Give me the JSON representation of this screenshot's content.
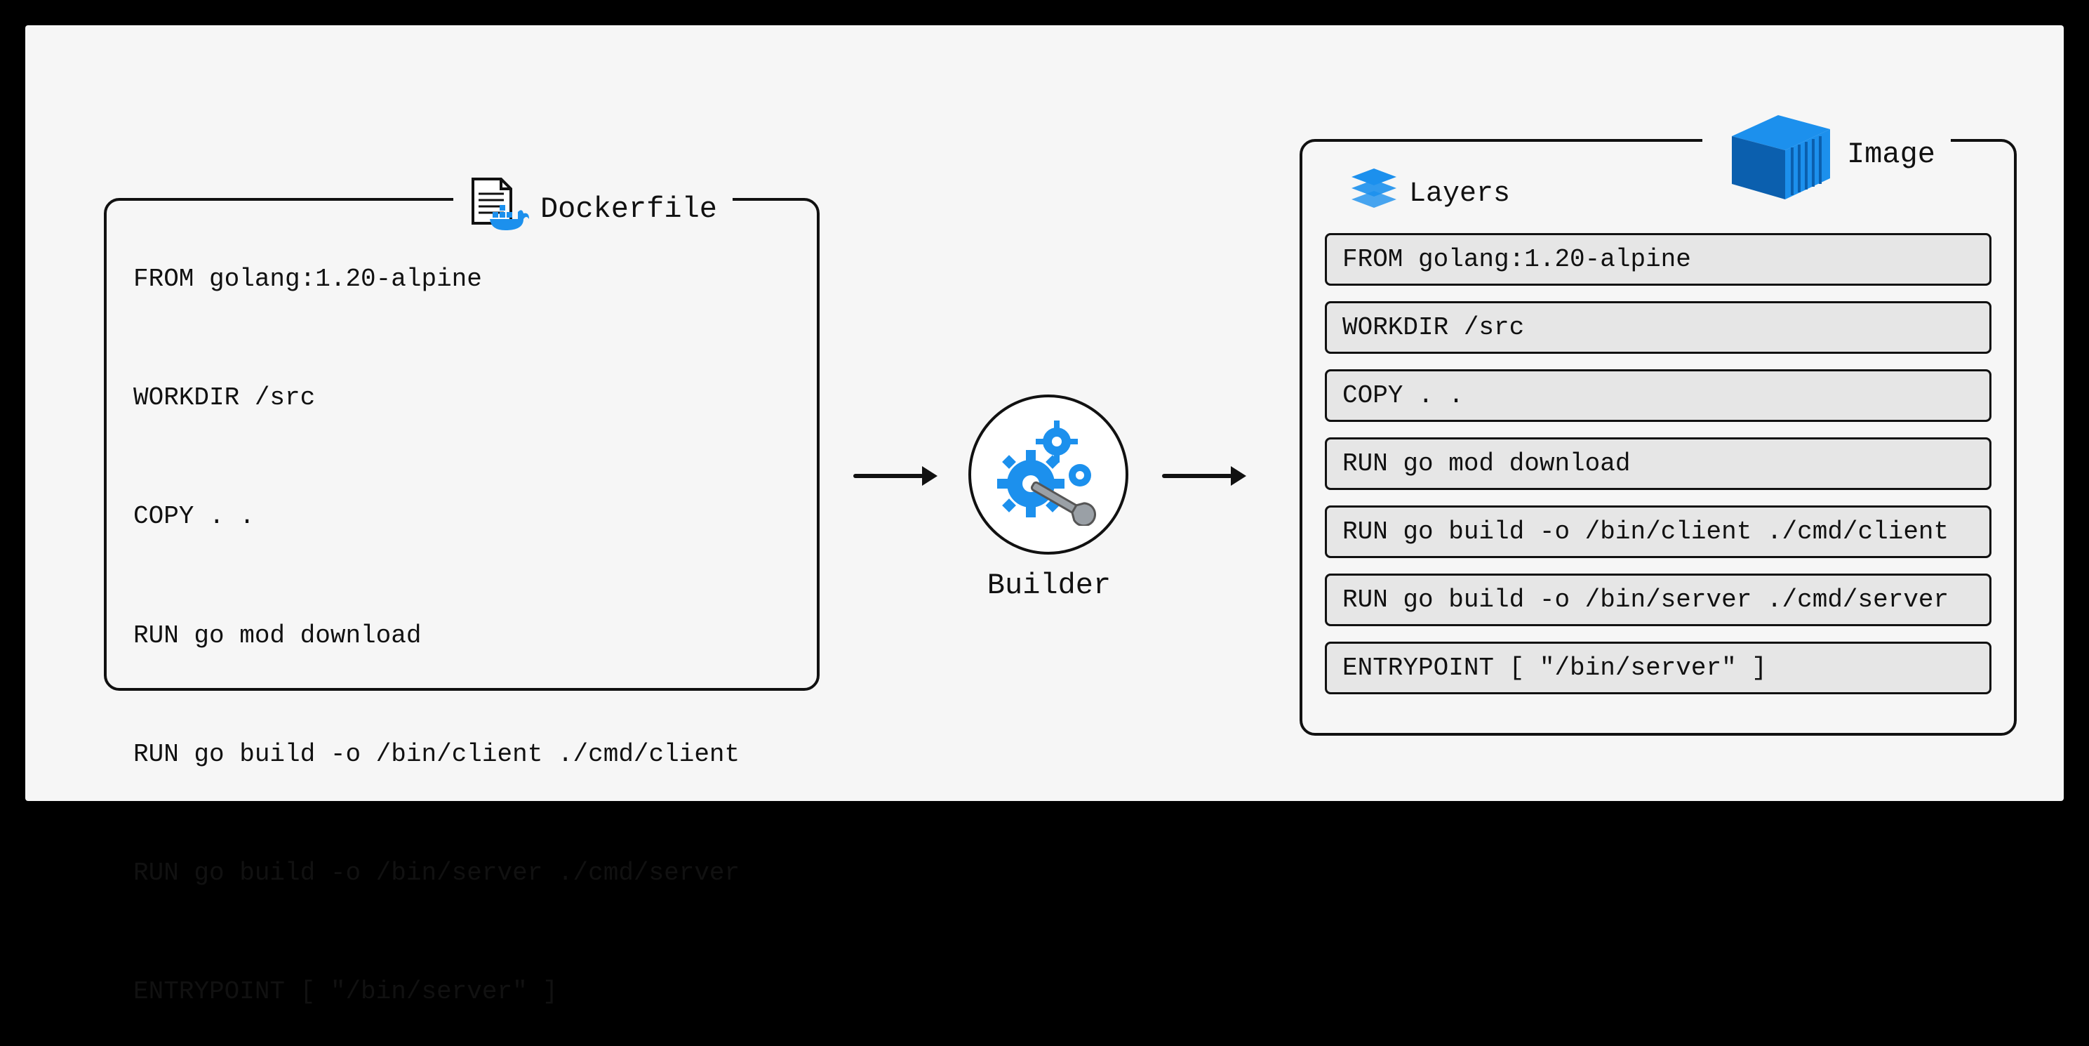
{
  "dockerfile": {
    "label": "Dockerfile",
    "code": "FROM golang:1.20-alpine\n\nWORKDIR /src\n\nCOPY . .\n\nRUN go mod download\n\nRUN go build -o /bin/client ./cmd/client\n\nRUN go build -o /bin/server ./cmd/server\n\nENTRYPOINT [ \"/bin/server\" ]"
  },
  "builder": {
    "label": "Builder"
  },
  "image": {
    "label": "Image",
    "layers_label": "Layers",
    "layers": [
      "FROM golang:1.20-alpine",
      "WORKDIR /src",
      "COPY . .",
      "RUN go mod download",
      "RUN go build -o /bin/client ./cmd/client",
      "RUN go build -o /bin/server ./cmd/server",
      "ENTRYPOINT [ \"/bin/server\" ]"
    ]
  },
  "colors": {
    "accent": "#1C90ED"
  }
}
